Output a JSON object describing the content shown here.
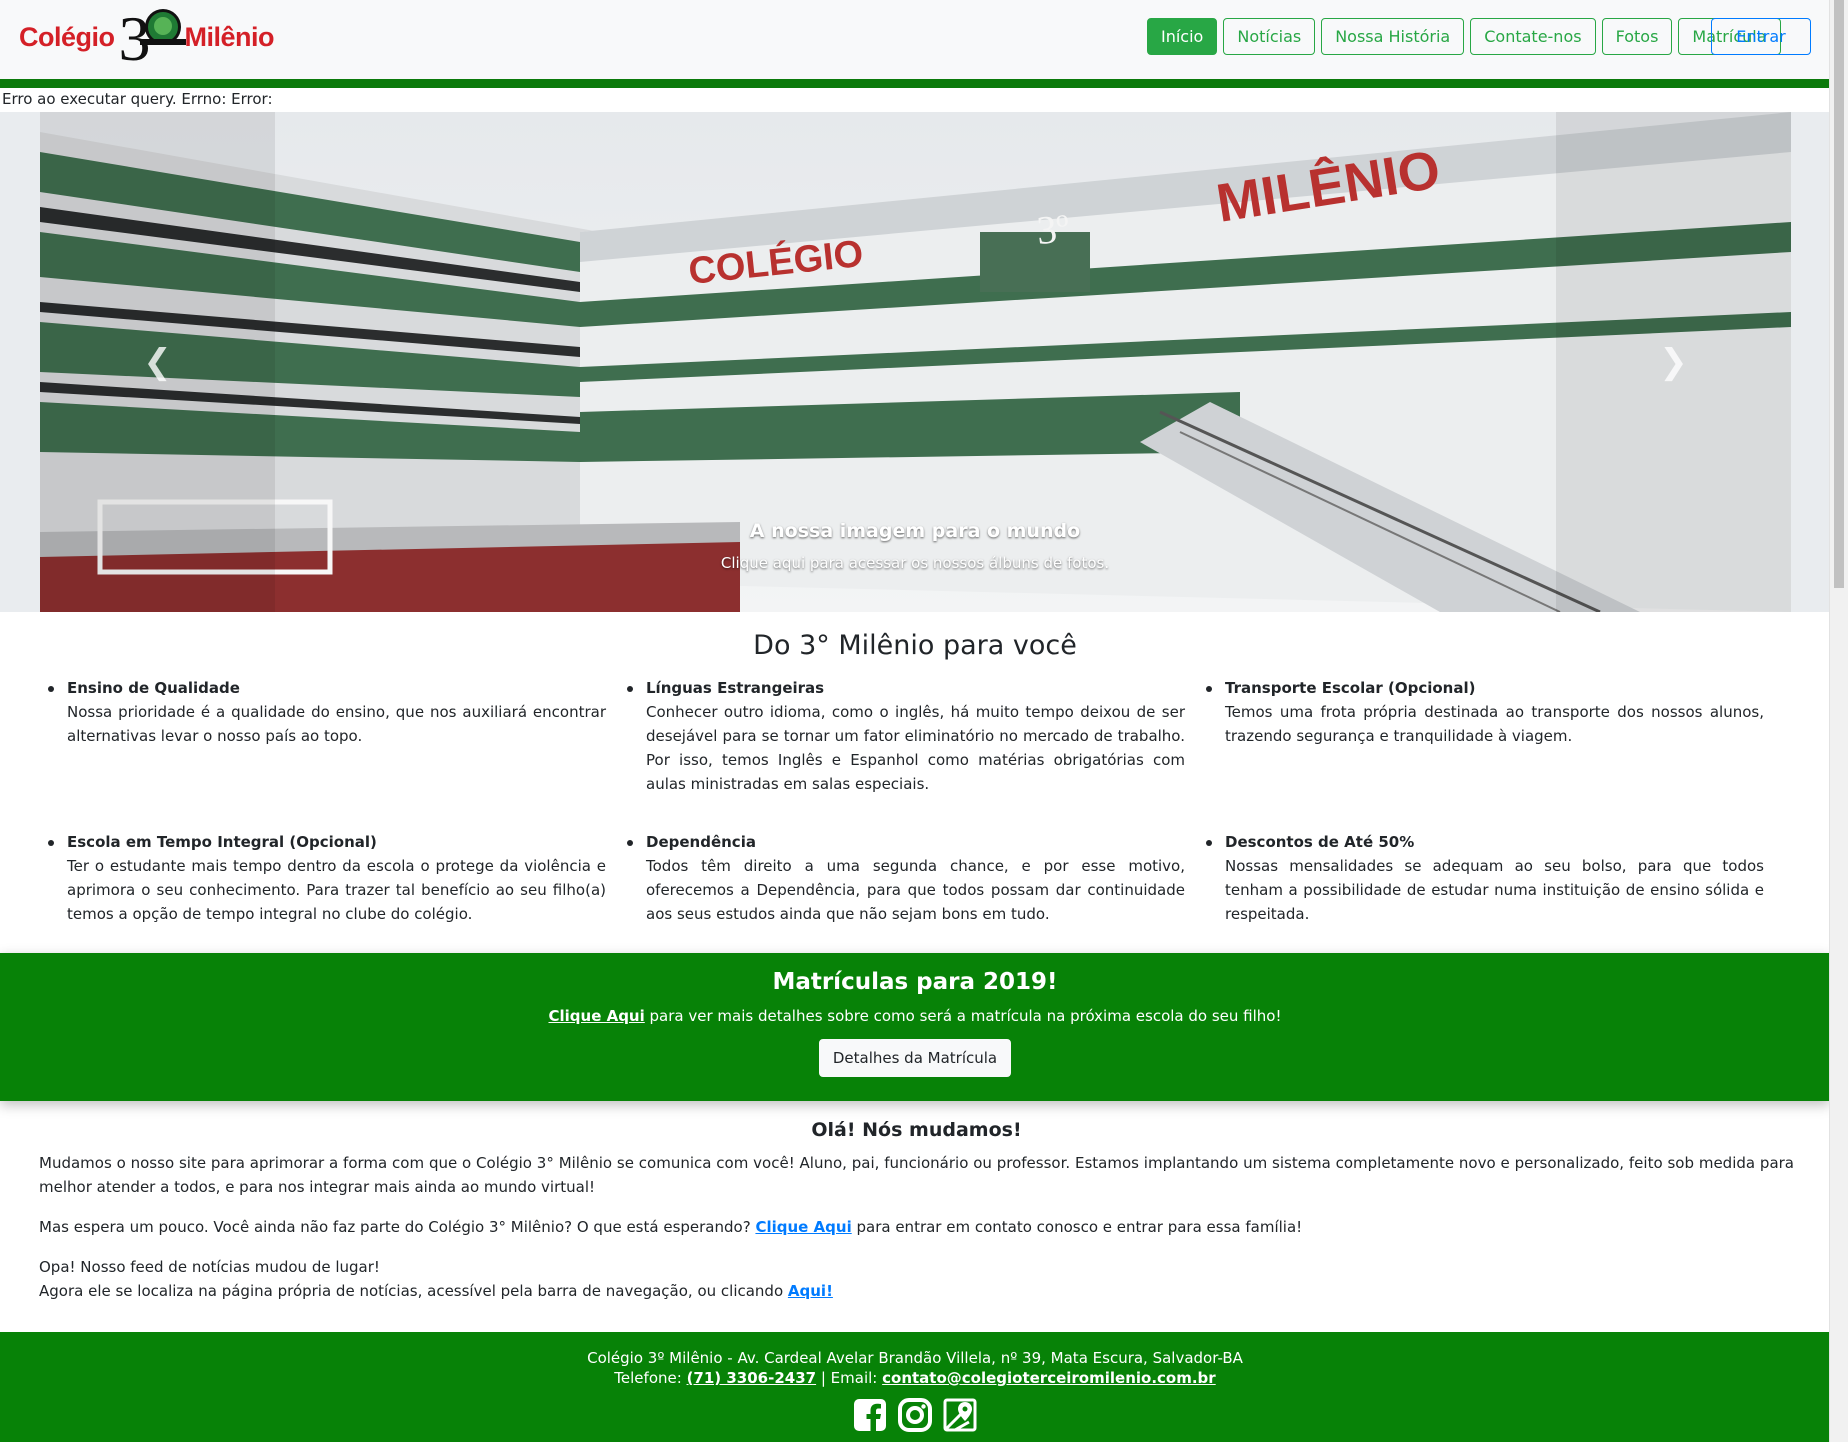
{
  "brand": {
    "word1": "Colégio",
    "numeral": "3",
    "word2": "Milênio"
  },
  "nav": {
    "items": [
      "Início",
      "Notícias",
      "Nossa História",
      "Contate-nos",
      "Fotos",
      "Matrícula"
    ],
    "active": "Início",
    "login": "Entrar"
  },
  "error_text": "Erro ao executar query. Errno: Error:",
  "carousel": {
    "caption_title": "A nossa imagem para o mundo",
    "caption_sub": "Clique aqui para acessar os nossos álbuns de fotos.",
    "photo_sign1": "COLÉGIO",
    "photo_sign2": "3º",
    "photo_sign3": "MILÊNIO",
    "prev_icon": "chevron-left-icon",
    "next_icon": "chevron-right-icon"
  },
  "features": {
    "title": "Do 3° Milênio para você",
    "items": [
      {
        "title": "Ensino de Qualidade",
        "text": "Nossa prioridade é a qualidade do ensino, que nos auxiliará encontrar alternativas levar o nosso país ao topo."
      },
      {
        "title": "Línguas Estrangeiras",
        "text": "Conhecer outro idioma, como o inglês, há muito tempo deixou de ser desejável para se tornar um fator eliminatório no mercado de trabalho. Por isso, temos Inglês e Espanhol como matérias obrigatórias com aulas ministradas em salas especiais."
      },
      {
        "title": "Transporte Escolar (Opcional)",
        "text": "Temos uma frota própria destinada ao transporte dos nossos alunos, trazendo segurança e tranquilidade à viagem."
      },
      {
        "title": "Escola em Tempo Integral (Opcional)",
        "text": "Ter o estudante mais tempo dentro da escola o protege da violência e aprimora o seu conhecimento. Para trazer tal benefício ao seu filho(a) temos a opção de tempo integral no clube do colégio."
      },
      {
        "title": "Dependência",
        "text": "Todos têm direito a uma segunda chance, e por esse motivo, oferecemos a Dependência, para que todos possam dar continuidade aos seus estudos ainda que não sejam bons em tudo."
      },
      {
        "title": "Descontos de Até 50%",
        "text": "Nossas mensalidades se adequam ao seu bolso, para que todos tenham a possibilidade de estudar numa instituição de ensino sólida e respeitada."
      }
    ]
  },
  "banner": {
    "title": "Matrículas para 2019!",
    "link": "Clique Aqui",
    "text": " para ver mais detalhes sobre como será a matrícula na próxima escola do seu filho!",
    "button": "Detalhes da Matrícula"
  },
  "news": {
    "title": "Olá! Nós mudamos!",
    "p1": "Mudamos o nosso site para aprimorar a forma com que o Colégio 3° Milênio se comunica com você! Aluno, pai, funcionário ou professor. Estamos implantando um sistema completamente novo e personalizado, feito sob medida para melhor atender a todos, e para nos integrar mais ainda ao mundo virtual!",
    "p2_before": "Mas espera um pouco. Você ainda não faz parte do Colégio 3° Milênio? O que está esperando? ",
    "p2_link": "Clique Aqui",
    "p2_after": " para entrar em contato conosco e entrar para essa família!",
    "p3_line1": "Opa! Nosso feed de notícias mudou de lugar!",
    "p3_line2": "Agora ele se localiza na página própria de notícias, acessível pela barra de navegação, ou clicando ",
    "p3_link": "Aqui!"
  },
  "footer": {
    "address": "Colégio 3º Milênio - Av. Cardeal Avelar Brandão Villela, nº 39, Mata Escura, Salvador-BA",
    "phone_label": "Telefone: ",
    "phone": "(71) 3306-2437",
    "email_label": " | Email: ",
    "email": "contato@colegioterceiromilenio.com.br",
    "socials": [
      "facebook-icon",
      "instagram-icon",
      "map-pin-icon"
    ]
  },
  "colors": {
    "green": "#078207",
    "nav_green": "#28a745",
    "brand_red": "#d42027",
    "link_blue": "#007bff"
  }
}
